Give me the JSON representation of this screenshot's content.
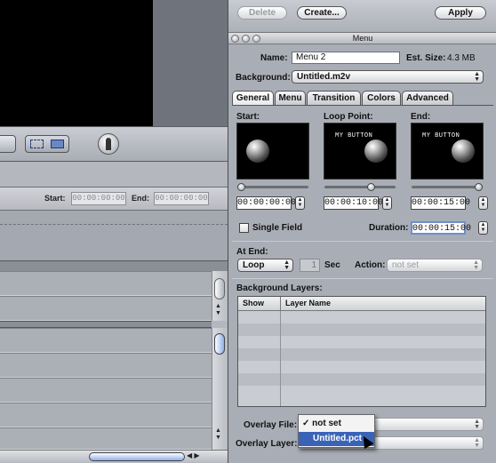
{
  "top_buttons": {
    "delete": "Delete",
    "create": "Create...",
    "apply": "Apply"
  },
  "window": {
    "title": "Menu"
  },
  "name": {
    "label": "Name:",
    "value": "Menu 2"
  },
  "est_size": {
    "label": "Est. Size:",
    "value": "4.3 MB"
  },
  "background": {
    "label": "Background:",
    "value": "Untitled.m2v"
  },
  "tabs": [
    {
      "label": "General"
    },
    {
      "label": "Menu"
    },
    {
      "label": "Transition"
    },
    {
      "label": "Colors"
    },
    {
      "label": "Advanced"
    }
  ],
  "thumbs": {
    "start": {
      "label": "Start:",
      "timecode": "00:00:00:00"
    },
    "loop": {
      "label": "Loop Point:",
      "timecode": "00:00:10:00",
      "text": "MY BUTTON"
    },
    "end": {
      "label": "End:",
      "timecode": "00:00:15:00",
      "text": "MY BUTTON"
    }
  },
  "single_field": {
    "label": "Single Field",
    "checked": false
  },
  "duration": {
    "label": "Duration:",
    "value": "00:00:15:00"
  },
  "at_end": {
    "label": "At End:",
    "value": "Loop",
    "count": "1",
    "sec": "Sec"
  },
  "action": {
    "label": "Action:",
    "value": "not set"
  },
  "bg_layers": {
    "title": "Background Layers:",
    "columns": [
      "Show",
      "Layer Name"
    ]
  },
  "overlay_file": {
    "label": "Overlay File:"
  },
  "overlay_layer": {
    "label": "Overlay Layer:"
  },
  "overlay_menu": {
    "items": [
      {
        "label": "not set",
        "checked": true
      },
      {
        "label": "Untitled.pct",
        "highlighted": true
      }
    ]
  },
  "timeline": {
    "start_label": "Start:",
    "start_value": "00:00:00:00",
    "end_label": "End:",
    "end_value": "00:00:00:00"
  }
}
